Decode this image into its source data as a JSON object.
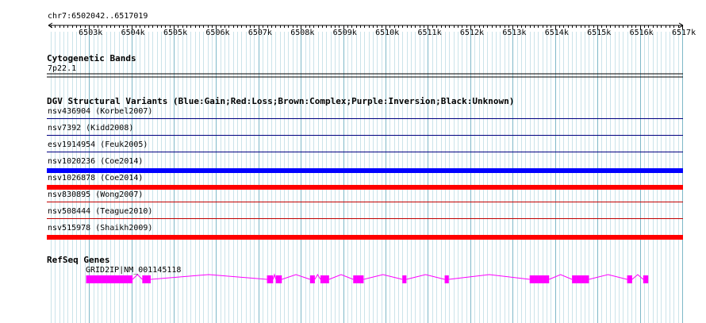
{
  "ruler": {
    "range_label": "chr7:6502042..6517019",
    "start": 6502042,
    "end": 6517019,
    "ticks": [
      {
        "pos": 6503000,
        "label": "6503k"
      },
      {
        "pos": 6504000,
        "label": "6504k"
      },
      {
        "pos": 6505000,
        "label": "6505k"
      },
      {
        "pos": 6506000,
        "label": "6506k"
      },
      {
        "pos": 6507000,
        "label": "6507k"
      },
      {
        "pos": 6508000,
        "label": "6508k"
      },
      {
        "pos": 6509000,
        "label": "6509k"
      },
      {
        "pos": 6510000,
        "label": "6510k"
      },
      {
        "pos": 6511000,
        "label": "6511k"
      },
      {
        "pos": 6512000,
        "label": "6512k"
      },
      {
        "pos": 6513000,
        "label": "6513k"
      },
      {
        "pos": 6514000,
        "label": "6514k"
      },
      {
        "pos": 6515000,
        "label": "6515k"
      },
      {
        "pos": 6516000,
        "label": "6516k"
      },
      {
        "pos": 6517000,
        "label": "6517k"
      }
    ]
  },
  "cytoband": {
    "title": "Cytogenetic Bands",
    "band": "7p22.1"
  },
  "dgv": {
    "title": "DGV Structural Variants (Blue:Gain;Red:Loss;Brown:Complex;Purple:Inversion;Black:Unknown)",
    "colors": {
      "gain": "#0000ff",
      "loss": "#ff0000",
      "thin_gain": "#000080",
      "thin_loss": "#c00000"
    },
    "variants": [
      {
        "label": "nsv436904 (Korbel2007)",
        "type": "gain",
        "thick": false
      },
      {
        "label": "nsv7392 (Kidd2008)",
        "type": "gain",
        "thick": false
      },
      {
        "label": "esv1914954 (Feuk2005)",
        "type": "gain",
        "thick": false
      },
      {
        "label": "nsv1020236 (Coe2014)",
        "type": "gain",
        "thick": true
      },
      {
        "label": "nsv1026878 (Coe2014)",
        "type": "loss",
        "thick": true
      },
      {
        "label": "nsv830895 (Wong2007)",
        "type": "loss",
        "thick": false
      },
      {
        "label": "nsv508444 (Teague2010)",
        "type": "loss",
        "thick": false
      },
      {
        "label": "nsv515978 (Shaikh2009)",
        "type": "loss",
        "thick": true
      }
    ]
  },
  "refseq": {
    "title": "RefSeq Genes",
    "gene_label": "GRID2IP|NM_001145118",
    "color": "#ff00ff",
    "exons": [
      [
        6502932,
        6504030
      ],
      [
        6504258,
        6504456
      ],
      [
        6507201,
        6507346
      ],
      [
        6507409,
        6507551
      ],
      [
        6508218,
        6508330
      ],
      [
        6508462,
        6508666
      ],
      [
        6509236,
        6509482
      ],
      [
        6510395,
        6510492
      ],
      [
        6511395,
        6511492
      ],
      [
        6513400,
        6513860
      ],
      [
        6514400,
        6514800
      ],
      [
        6515700,
        6515820
      ],
      [
        6516080,
        6516200
      ]
    ]
  }
}
